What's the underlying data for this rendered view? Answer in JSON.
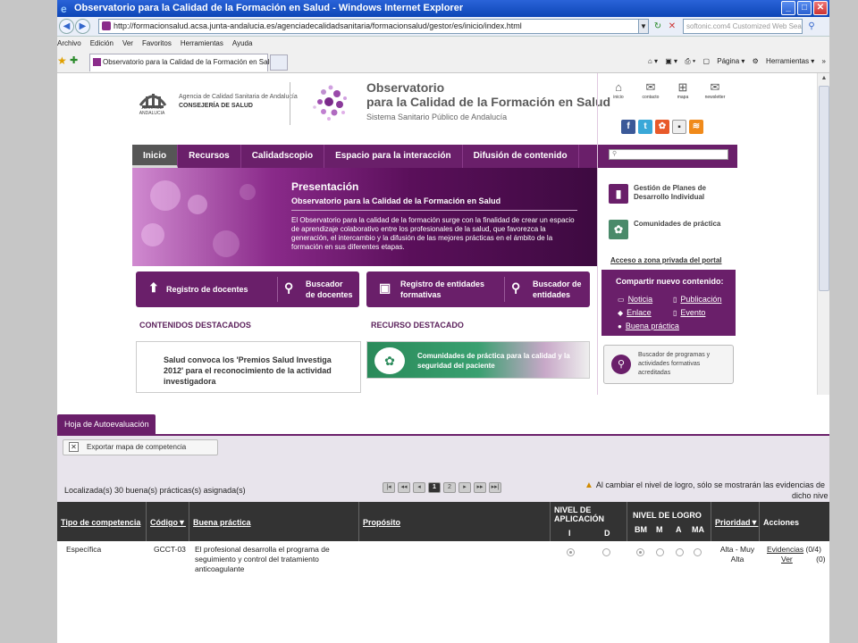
{
  "browser": {
    "title": "Observatorio para la Calidad de la Formación en Salud - Windows Internet Explorer",
    "url": "http://formacionsalud.acsa.junta-andalucia.es/agenciadecalidadsanitaria/formacionsalud/gestor/es/inicio/index.html",
    "search_placeholder": "softonic.com4 Customized Web Search",
    "menu": [
      "Archivo",
      "Edición",
      "Ver",
      "Favoritos",
      "Herramientas",
      "Ayuda"
    ],
    "tab_label": "Observatorio para la Calidad de la Formación en Salud",
    "cmd_page": "Página",
    "cmd_tools": "Herramientas"
  },
  "site": {
    "junta_label": "JUNTA DE ANDALUCIA",
    "agency_line1": "Agencia de Calidad Sanitaria de Andalucía",
    "agency_line2": "CONSEJERÍA DE SALUD",
    "title1": "Observatorio",
    "title2": "para la Calidad de la Formación en Salud",
    "title3": "Sistema Sanitario Público de Andalucía",
    "nav": [
      "Inicio",
      "Recursos",
      "Calidadscopio",
      "Espacio para la interacción",
      "Difusión de contenido"
    ],
    "hero_title": "Presentación",
    "hero_sub": "Observatorio para la Calidad de la Formación en Salud",
    "hero_body": "El Observatorio para la calidad de la formación surge con la finalidad de crear un espacio de aprendizaje colaborativo entre los profesionales de la salud, que favorezca la generación, el intercambio y la difusión de las mejores prácticas en el ámbito de la formación en sus diferentes etapas.",
    "btn_registro_docentes": "Registro de docentes",
    "btn_buscador_docentes": "Buscador de docentes",
    "btn_registro_entidades": "Registro de entidades formativas",
    "btn_buscador_entidades": "Buscador de entidades",
    "section_contenidos": "CONTENIDOS DESTACADOS",
    "section_recurso": "RECURSO DESTACADO",
    "news": "Salud convoca los 'Premios Salud Investiga 2012' para el reconocimiento de la actividad investigadora",
    "recurso": "Comunidades de práctica para la calidad y la seguridad del paciente",
    "top_icons": [
      "inicio",
      "contacto",
      "mapa",
      "newsletter"
    ],
    "gestion": "Gestión de Planes de Desarrollo Individual",
    "comunidades": "Comunidades de práctica",
    "private": "Acceso a zona privada del portal",
    "share_title": "Compartir nuevo contenido:",
    "share_items": [
      "Noticia",
      "Publicación",
      "Enlace",
      "Evento",
      "Buena práctica"
    ],
    "buscador_programas": "Buscador de programas y actividades formativas acreditadas"
  },
  "app": {
    "tab": "Hoja de Autoevaluación",
    "export": "Exportar mapa de competencia",
    "found": "Localizada(s) 30 buena(s) prácticas(s) asignada(s)",
    "pages": [
      "1",
      "2"
    ],
    "notice": "Al cambiar el nivel de logro, sólo se mostrarán las evidencias de",
    "notice2": "dicho nive",
    "columns": {
      "tipo": "Tipo de competencia",
      "codigo": "Código▼",
      "buena": "Buena práctica",
      "proposito": "Propósito",
      "nivel_aplicacion": "NIVEL DE APLICACIÓN",
      "nivel_aplicacion_sub": [
        "I",
        "D"
      ],
      "nivel_logro": "NIVEL DE LOGRO",
      "nivel_logro_sub": [
        "BM",
        "M",
        "A",
        "MA"
      ],
      "prioridad": "Prioridad▼",
      "acciones": "Acciones"
    },
    "row": {
      "tipo": "Específica",
      "codigo": "GCCT-03",
      "buena": "El profesional desarrolla el programa de seguimiento y control del tratamiento anticoagulante",
      "prioridad": "Alta - Muy Alta",
      "evidencias": "Evidencias",
      "evidencias_count": "(0/4)",
      "ver": "Ver",
      "ver_count": "(0)"
    }
  }
}
